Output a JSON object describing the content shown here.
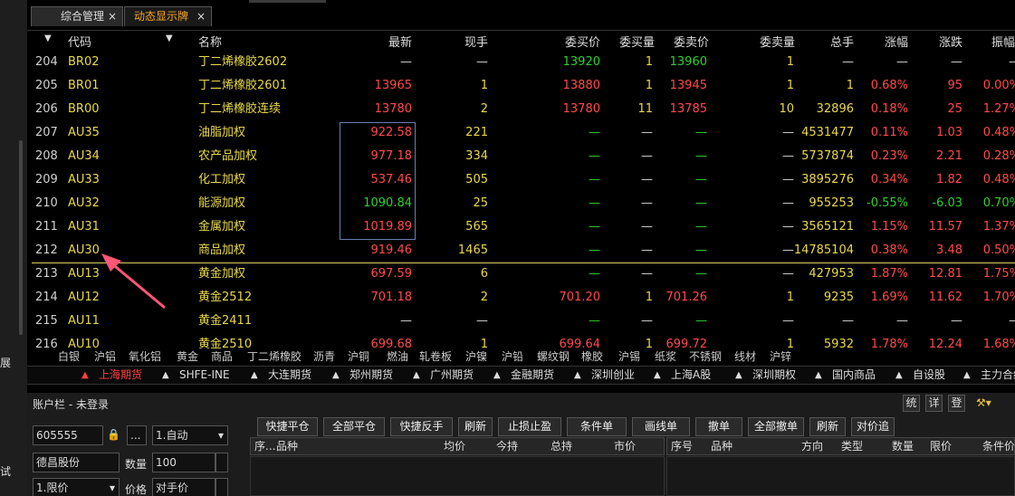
{
  "left_glyphs": [
    "展",
    "试"
  ],
  "tabs": [
    {
      "label": "综合管理"
    },
    {
      "label": "动态显示牌"
    }
  ],
  "tab_close": "×",
  "columns": {
    "sort": "▼",
    "code": "代码",
    "pin": "▼",
    "name": "名称",
    "last": "最新",
    "cur": "现手",
    "bid": "委买价",
    "bidv": "委买量",
    "ask": "委卖价",
    "askv": "委卖量",
    "vol": "总手",
    "pct": "涨幅",
    "chg": "涨跌",
    "amp": "振幅"
  },
  "rows": [
    {
      "no": "204",
      "code": "BR02",
      "name": "丁二烯橡胶2602",
      "last": "—",
      "cur": "—",
      "bid": "13920",
      "bidv": "1",
      "ask": "13960",
      "askv": "1",
      "vol": "—",
      "pct": "—",
      "chg": "—",
      "amp": "—"
    },
    {
      "no": "205",
      "code": "BR01",
      "name": "丁二烯橡胶2601",
      "last": "13965",
      "cur": "1",
      "bid": "13880",
      "bidv": "1",
      "ask": "13945",
      "askv": "1",
      "vol": "1",
      "pct": "0.68%",
      "chg": "95",
      "amp": "0.00%"
    },
    {
      "no": "206",
      "code": "BR00",
      "name": "丁二烯橡胶连续",
      "last": "13780",
      "cur": "2",
      "bid": "13780",
      "bidv": "11",
      "ask": "13785",
      "askv": "10",
      "vol": "32896",
      "pct": "0.18%",
      "chg": "25",
      "amp": "1.27%"
    },
    {
      "no": "207",
      "code": "AU35",
      "name": "油脂加权",
      "last": "922.58",
      "cur": "221",
      "bid": "—",
      "bidv": "—",
      "ask": "—",
      "askv": "—",
      "vol": "4531477",
      "pct": "0.11%",
      "chg": "1.03",
      "amp": "0.48%"
    },
    {
      "no": "208",
      "code": "AU34",
      "name": "农产品加权",
      "last": "977.18",
      "cur": "334",
      "bid": "—",
      "bidv": "—",
      "ask": "—",
      "askv": "—",
      "vol": "5737874",
      "pct": "0.23%",
      "chg": "2.21",
      "amp": "0.28%"
    },
    {
      "no": "209",
      "code": "AU33",
      "name": "化工加权",
      "last": "537.46",
      "cur": "505",
      "bid": "—",
      "bidv": "—",
      "ask": "—",
      "askv": "—",
      "vol": "3895276",
      "pct": "0.34%",
      "chg": "1.82",
      "amp": "0.48%"
    },
    {
      "no": "210",
      "code": "AU32",
      "name": "能源加权",
      "last": "1090.84",
      "cur": "25",
      "bid": "—",
      "bidv": "—",
      "ask": "—",
      "askv": "—",
      "vol": "955253",
      "pct": "-0.55%",
      "chg": "-6.03",
      "amp": "0.70%"
    },
    {
      "no": "211",
      "code": "AU31",
      "name": "金属加权",
      "last": "1019.89",
      "cur": "565",
      "bid": "—",
      "bidv": "—",
      "ask": "—",
      "askv": "—",
      "vol": "3565121",
      "pct": "1.15%",
      "chg": "11.57",
      "amp": "1.37%"
    },
    {
      "no": "212",
      "code": "AU30",
      "name": "商品加权",
      "last": "919.46",
      "cur": "1465",
      "bid": "—",
      "bidv": "—",
      "ask": "—",
      "askv": "—",
      "vol": "14785104",
      "pct": "0.38%",
      "chg": "3.48",
      "amp": "0.50%"
    },
    {
      "no": "213",
      "code": "AU13",
      "name": "黄金加权",
      "last": "697.59",
      "cur": "6",
      "bid": "—",
      "bidv": "—",
      "ask": "—",
      "askv": "—",
      "vol": "427953",
      "pct": "1.87%",
      "chg": "12.81",
      "amp": "1.75%"
    },
    {
      "no": "214",
      "code": "AU12",
      "name": "黄金2512",
      "last": "701.18",
      "cur": "2",
      "bid": "701.20",
      "bidv": "1",
      "ask": "701.26",
      "askv": "1",
      "vol": "9235",
      "pct": "1.69%",
      "chg": "11.62",
      "amp": "1.70%"
    },
    {
      "no": "215",
      "code": "AU11",
      "name": "黄金2411",
      "last": "—",
      "cur": "—",
      "bid": "—",
      "bidv": "—",
      "ask": "—",
      "askv": "—",
      "vol": "—",
      "pct": "—",
      "chg": "—",
      "amp": "—"
    },
    {
      "no": "216",
      "code": "AU10",
      "name": "黄金2510",
      "last": "699.68",
      "cur": "1",
      "bid": "699.64",
      "bidv": "1",
      "ask": "699.72",
      "askv": "1",
      "vol": "5932",
      "pct": "1.78%",
      "chg": "12.24",
      "amp": "1.68%"
    }
  ],
  "categories": [
    "白银",
    "沪铝",
    "氧化铝",
    "黄金",
    "商品",
    "丁二烯橡胶",
    "沥青",
    "沪铜",
    "燃油",
    "轧卷板",
    "沪镍",
    "沪铅",
    "螺纹钢",
    "橡胶",
    "沪锡",
    "纸浆",
    "不锈钢",
    "线材",
    "沪锌"
  ],
  "markets": [
    "上海期货",
    "SHFE-INE",
    "大连期货",
    "郑州期货",
    "广州期货",
    "金融期货",
    "深圳创业",
    "上海A股",
    "深圳期权",
    "国内商品",
    "自设股",
    "主力合约"
  ],
  "market_arrow": "▲",
  "account": {
    "title": "账户栏 - 未登录",
    "side_buttons": [
      "统",
      "详",
      "登"
    ],
    "tool_icon": "⚒▾",
    "code_value": "605555",
    "mode_value": "1.自动",
    "name_value": "德昌股份",
    "qty_label": "数量",
    "qty_value": "100",
    "type_value": "1.限价",
    "price_label": "价格",
    "price_value": "对手价",
    "lock_icon": "🔒",
    "dots": "...",
    "dropdown": "▾",
    "actions": [
      "快捷平仓",
      "全部平仓",
      "快捷反手",
      "刷新",
      "止损止盈",
      "条件单",
      "画线单",
      "撤单",
      "全部撤单",
      "刷新",
      "对价追"
    ],
    "pos_cols": [
      "序...",
      "品种",
      "均价",
      "今持",
      "总持",
      "市价"
    ],
    "ord_cols": [
      "序号",
      "品种",
      "方向",
      "类型",
      "数量",
      "限价",
      "条件价"
    ]
  }
}
